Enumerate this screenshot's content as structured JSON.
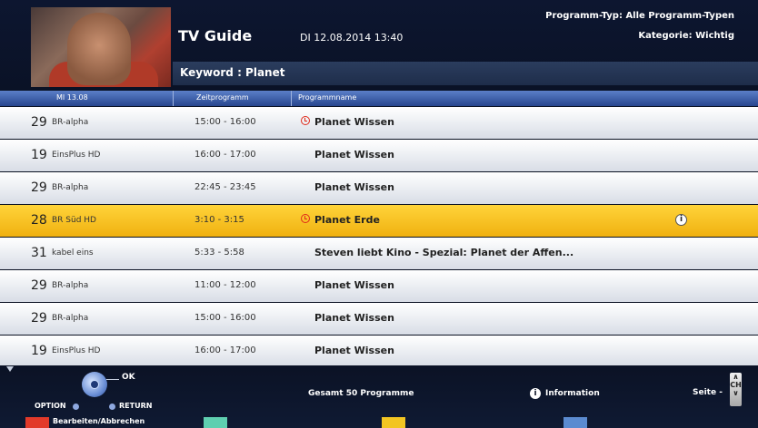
{
  "header": {
    "title": "TV Guide",
    "datetime": "DI 12.08.2014 13:40",
    "programm_typ": "Programm-Typ: Alle Programm-Typen",
    "kategorie": "Kategorie: Wichtig",
    "keyword": "Keyword :  Planet"
  },
  "columns": {
    "date": "MI 13.08",
    "time": "Zeitprogramm",
    "name": "Programmname"
  },
  "rows": [
    {
      "num": "29",
      "channel": "BR-alpha",
      "time": "15:00  -  16:00",
      "program": "Planet Wissen"
    },
    {
      "num": "19",
      "channel": "EinsPlus HD",
      "time": "16:00  -  17:00",
      "program": "Planet Wissen"
    },
    {
      "num": "29",
      "channel": "BR-alpha",
      "time": "22:45  -  23:45",
      "program": "Planet Wissen"
    },
    {
      "num": "28",
      "channel": "BR Süd HD",
      "time": "3:10  -  3:15",
      "program": "Planet Erde"
    },
    {
      "num": "31",
      "channel": "kabel eins",
      "time": "5:33  -  5:58",
      "program": "Steven liebt Kino - Spezial: Planet der Affen..."
    },
    {
      "num": "29",
      "channel": "BR-alpha",
      "time": "11:00  -  12:00",
      "program": "Planet Wissen"
    },
    {
      "num": "29",
      "channel": "BR-alpha",
      "time": "15:00  -  16:00",
      "program": "Planet Wissen"
    },
    {
      "num": "19",
      "channel": "EinsPlus HD",
      "time": "16:00  -  17:00",
      "program": "Planet Wissen"
    }
  ],
  "footer": {
    "ok": "OK",
    "option": "OPTION",
    "return": "RETURN",
    "gesamt": "Gesamt 50 Programme",
    "info_glyph": "i",
    "information": "Information",
    "seite": "Seite -",
    "seite_btn_top": "∧",
    "seite_btn_mid": "CH",
    "seite_btn_bot": "∨",
    "bearbeiten": "Bearbeiten/Abbrechen"
  },
  "colors": {
    "selected_row": "#f2c522",
    "red_button": "#e23a2a",
    "green_button": "#5fcfb0",
    "yellow_button": "#f2c522",
    "blue_button": "#5b8bd0"
  },
  "icons": {
    "reminder": "clock-icon",
    "info": "info-icon"
  }
}
